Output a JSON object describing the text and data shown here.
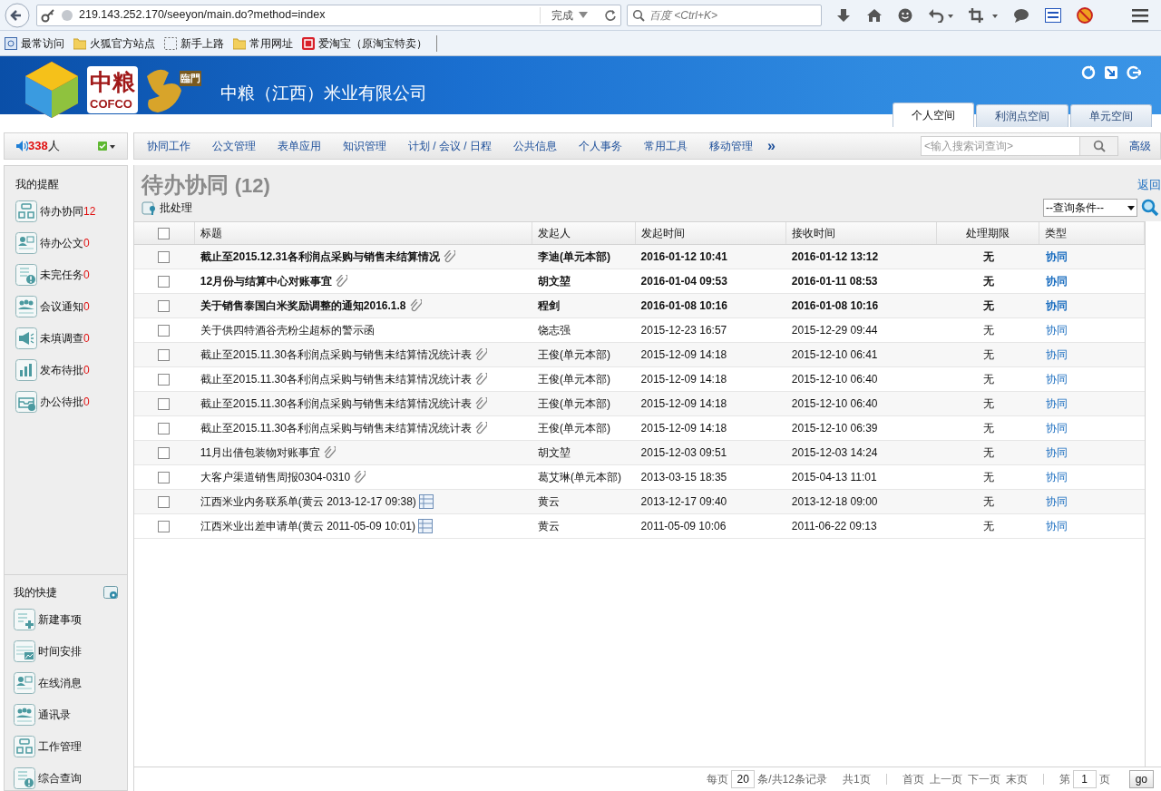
{
  "browser": {
    "url": "219.143.252.170/seeyon/main.do?method=index",
    "status": "完成",
    "search_placeholder": "百度 <Ctrl+K>",
    "bookmarks": [
      "最常访问",
      "火狐官方站点",
      "新手上路",
      "常用网址",
      "爱淘宝（原淘宝特卖）"
    ]
  },
  "header": {
    "title": "中粮（江西）米业有限公司",
    "logo_cn": "中粮",
    "logo_en": "COFCO",
    "logo_badge": "臨門",
    "tabs": [
      {
        "label": "个人空间",
        "selected": true
      },
      {
        "label": "利润点空间",
        "selected": false
      },
      {
        "label": "单元空间",
        "selected": false
      }
    ]
  },
  "online": {
    "count": "338",
    "unit": "人"
  },
  "nav": {
    "items": [
      "协同工作",
      "公文管理",
      "表单应用",
      "知识管理",
      "计划 / 会议 / 日程",
      "公共信息",
      "个人事务",
      "常用工具",
      "移动管理"
    ],
    "more": "»",
    "search_placeholder": "<输入搜索词查询>",
    "advanced": "高级"
  },
  "sidebar": {
    "reminders_title": "我的提醒",
    "reminders": [
      {
        "label": "待办协同",
        "count": "12"
      },
      {
        "label": "待办公文",
        "count": "0"
      },
      {
        "label": "未完任务",
        "count": "0"
      },
      {
        "label": "会议通知",
        "count": "0"
      },
      {
        "label": "未填调查",
        "count": "0"
      },
      {
        "label": "发布待批",
        "count": "0"
      },
      {
        "label": "办公待批",
        "count": "0"
      }
    ],
    "shortcuts_title": "我的快捷",
    "shortcuts": [
      "新建事项",
      "时间安排",
      "在线消息",
      "通讯录",
      "工作管理",
      "综合查询"
    ]
  },
  "main": {
    "select_all_checked": false,
    "title": "待办协同",
    "count": "(12)",
    "back": "返回",
    "batch": "批处理",
    "query": "--查询条件--",
    "columns": [
      "标题",
      "发起人",
      "发起时间",
      "接收时间",
      "处理期限",
      "类型"
    ],
    "rows": [
      {
        "title": "截止至2015.12.31各利润点采购与销售未结算情况",
        "kind": "attachment",
        "sender": "李迪(单元本部)",
        "sent": "2016-01-12 10:41",
        "received": "2016-01-12 13:12",
        "deadline": "无",
        "type": "协同",
        "unread": true,
        "checked": false
      },
      {
        "title": "12月份与结算中心对账事宜",
        "kind": "attachment",
        "sender": "胡文堃",
        "sent": "2016-01-04 09:53",
        "received": "2016-01-11 08:53",
        "deadline": "无",
        "type": "协同",
        "unread": true,
        "checked": false
      },
      {
        "title": "关于销售泰国白米奖励调整的通知2016.1.8",
        "kind": "attachment",
        "sender": "程剑",
        "sent": "2016-01-08 10:16",
        "received": "2016-01-08 10:16",
        "deadline": "无",
        "type": "协同",
        "unread": true,
        "checked": false
      },
      {
        "title": "关于供四特酒谷壳粉尘超标的警示函",
        "kind": "plain",
        "sender": "饶志强",
        "sent": "2015-12-23 16:57",
        "received": "2015-12-29 09:44",
        "deadline": "无",
        "type": "协同",
        "unread": false,
        "checked": false
      },
      {
        "title": "截止至2015.11.30各利润点采购与销售未结算情况统计表",
        "kind": "attachment",
        "sender": "王俊(单元本部)",
        "sent": "2015-12-09 14:18",
        "received": "2015-12-10 06:41",
        "deadline": "无",
        "type": "协同",
        "unread": false,
        "checked": false
      },
      {
        "title": "截止至2015.11.30各利润点采购与销售未结算情况统计表",
        "kind": "attachment",
        "sender": "王俊(单元本部)",
        "sent": "2015-12-09 14:18",
        "received": "2015-12-10 06:40",
        "deadline": "无",
        "type": "协同",
        "unread": false,
        "checked": false
      },
      {
        "title": "截止至2015.11.30各利润点采购与销售未结算情况统计表",
        "kind": "attachment",
        "sender": "王俊(单元本部)",
        "sent": "2015-12-09 14:18",
        "received": "2015-12-10 06:40",
        "deadline": "无",
        "type": "协同",
        "unread": false,
        "checked": false
      },
      {
        "title": "截止至2015.11.30各利润点采购与销售未结算情况统计表",
        "kind": "attachment",
        "sender": "王俊(单元本部)",
        "sent": "2015-12-09 14:18",
        "received": "2015-12-10 06:39",
        "deadline": "无",
        "type": "协同",
        "unread": false,
        "checked": false
      },
      {
        "title": "11月出借包装物对账事宜",
        "kind": "attachment",
        "sender": "胡文堃",
        "sent": "2015-12-03 09:51",
        "received": "2015-12-03 14:24",
        "deadline": "无",
        "type": "协同",
        "unread": false,
        "checked": false
      },
      {
        "title": "大客户渠道销售周报0304-0310",
        "kind": "attachment",
        "sender": "葛艾琳(单元本部)",
        "sent": "2013-03-15 18:35",
        "received": "2015-04-13 11:01",
        "deadline": "无",
        "type": "协同",
        "unread": false,
        "checked": false
      },
      {
        "title": "江西米业内务联系单(黄云 2013-12-17 09:38)",
        "kind": "form",
        "sender": "黄云",
        "sent": "2013-12-17 09:40",
        "received": "2013-12-18 09:00",
        "deadline": "无",
        "type": "协同",
        "unread": false,
        "checked": false
      },
      {
        "title": "江西米业出差申请单(黄云 2011-05-09 10:01)",
        "kind": "form",
        "sender": "黄云",
        "sent": "2011-05-09 10:06",
        "received": "2011-06-22 09:13",
        "deadline": "无",
        "type": "协同",
        "unread": false,
        "checked": false
      }
    ],
    "pager": {
      "per_page_label": "每页",
      "per_page": "20",
      "records": "条/共12条记录",
      "pages": "共1页",
      "first": "首页",
      "prev": "上一页",
      "next": "下一页",
      "last": "末页",
      "page_prefix": "第",
      "page": "1",
      "page_suffix": "页",
      "go": "go"
    }
  }
}
